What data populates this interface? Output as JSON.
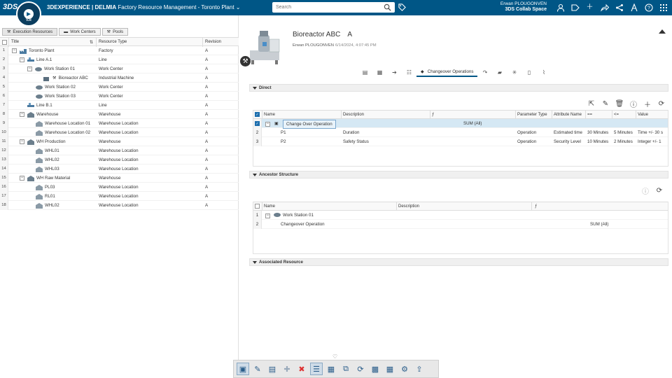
{
  "app": {
    "brand": "3DEXPERIENCE | DELMIA",
    "title": "Factory Resource Management - Toronto Plant",
    "compass_version": "V.R",
    "search_placeholder": "Search",
    "user_name": "Erwan PLOUGONVEN",
    "user_space": "3DS Collab Space"
  },
  "tabs": [
    {
      "label": "Execution Resources"
    },
    {
      "label": "Work Centers"
    },
    {
      "label": "Pools"
    }
  ],
  "tree": {
    "headers": {
      "title": "Title",
      "type": "Resource Type",
      "revision": "Revision"
    },
    "rows": [
      {
        "n": "1",
        "title": "Toronto Plant",
        "type": "Factory",
        "rev": "A"
      },
      {
        "n": "2",
        "title": "Line A.1",
        "type": "Line",
        "rev": "A"
      },
      {
        "n": "3",
        "title": "Work Station 01",
        "type": "Work Center",
        "rev": "A"
      },
      {
        "n": "4",
        "title": "Bioreactor ABC",
        "type": "Industrial Machine",
        "rev": "A"
      },
      {
        "n": "5",
        "title": "Work Station 02",
        "type": "Work Center",
        "rev": "A"
      },
      {
        "n": "6",
        "title": "Work Station 03",
        "type": "Work Center",
        "rev": "A"
      },
      {
        "n": "7",
        "title": "Line B.1",
        "type": "Line",
        "rev": "A"
      },
      {
        "n": "8",
        "title": "Warehouse",
        "type": "Warehouse",
        "rev": "A"
      },
      {
        "n": "9",
        "title": "Warehouse Location 01",
        "type": "Warehouse Location",
        "rev": "A"
      },
      {
        "n": "10",
        "title": "Warehouse Location 02",
        "type": "Warehouse Location",
        "rev": "A"
      },
      {
        "n": "11",
        "title": "WH Production",
        "type": "Warehouse",
        "rev": "A"
      },
      {
        "n": "12",
        "title": "WHL01",
        "type": "Warehouse Location",
        "rev": "A"
      },
      {
        "n": "13",
        "title": "WHL02",
        "type": "Warehouse Location",
        "rev": "A"
      },
      {
        "n": "14",
        "title": "WHL03",
        "type": "Warehouse Location",
        "rev": "A"
      },
      {
        "n": "15",
        "title": "WH Raw Material",
        "type": "Warehouse",
        "rev": "A"
      },
      {
        "n": "16",
        "title": "PL03",
        "type": "Warehouse Location",
        "rev": "A"
      },
      {
        "n": "17",
        "title": "RL01",
        "type": "Warehouse Location",
        "rev": "A"
      },
      {
        "n": "18",
        "title": "WHL02",
        "type": "Warehouse Location",
        "rev": "A"
      }
    ]
  },
  "object": {
    "title": "Bioreactor ABC",
    "revision": "A",
    "owner": "Erwan PLOUGONVEN",
    "timestamp": "6/14/2024, 4:07:45 PM",
    "active_tab": "Changeover Operations"
  },
  "sections": {
    "direct": "Direct",
    "ancestor": "Ancestor Structure",
    "associated": "Associated Resource"
  },
  "direct_grid": {
    "headers": {
      "name": "Name",
      "description": "Description",
      "formula": "ƒ",
      "param_type": "Parameter Type",
      "attr": "Attribute Name",
      "eq": "==",
      "le": "<=",
      "value": "Value"
    },
    "rows": [
      {
        "n": "1",
        "name": "Change Over Operation",
        "formula": "SUM (All)"
      },
      {
        "n": "2",
        "name": "P1",
        "description": "Duration",
        "param_type": "Operation",
        "attr": "Estimated time",
        "eq": "30 Minutes",
        "le": "5 Minutes",
        "value": "Time +/- 30 s"
      },
      {
        "n": "3",
        "name": "P2",
        "description": "Safety Status",
        "param_type": "Operation",
        "attr": "Security Level",
        "eq": "10 Minutes",
        "le": "2 Minutes",
        "value": "Integer +/- 1"
      }
    ]
  },
  "ancestor_grid": {
    "headers": {
      "name": "Name",
      "description": "Description",
      "formula": "ƒ"
    },
    "rows": [
      {
        "n": "1",
        "name": "Work Station 01",
        "formula": ""
      },
      {
        "n": "2",
        "name": "Changeover Operation",
        "formula": "SUM (All)"
      }
    ]
  }
}
